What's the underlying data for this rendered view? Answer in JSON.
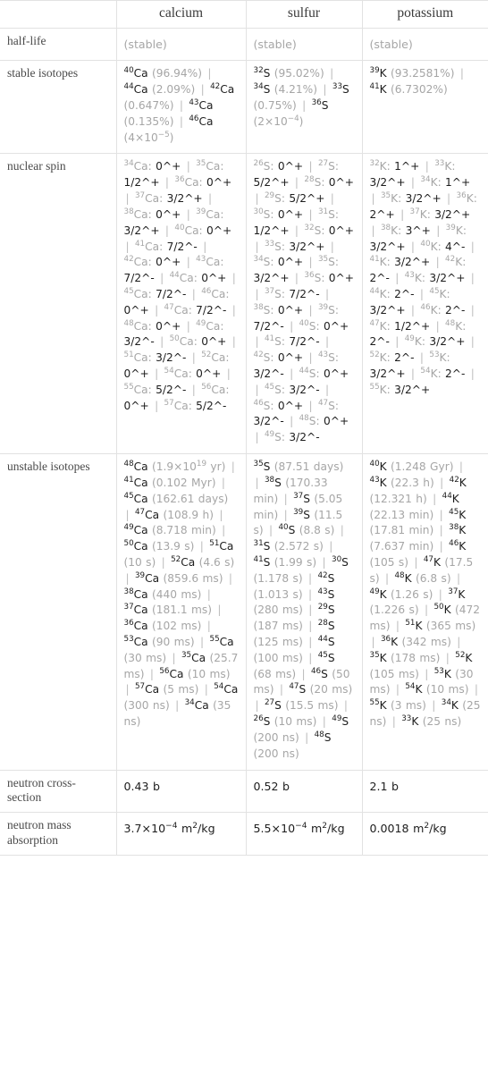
{
  "table": {
    "columns": [
      "",
      "calcium",
      "sulfur",
      "potassium"
    ],
    "rows": [
      {
        "label": "half-life",
        "kind": "plain",
        "cells": [
          {
            "type": "muted",
            "text": "(stable)"
          },
          {
            "type": "muted",
            "text": "(stable)"
          },
          {
            "type": "muted",
            "text": "(stable)"
          }
        ]
      },
      {
        "label": "stable isotopes",
        "kind": "isotopes-abundance",
        "cells": [
          {
            "items": [
              {
                "mass": "40",
                "sym": "Ca",
                "val": "(96.94%)"
              },
              {
                "mass": "44",
                "sym": "Ca",
                "val": "(2.09%)"
              },
              {
                "mass": "42",
                "sym": "Ca",
                "val": "(0.647%)"
              },
              {
                "mass": "43",
                "sym": "Ca",
                "val": "(0.135%)"
              },
              {
                "mass": "46",
                "sym": "Ca",
                "val": "(4×10^-5)"
              }
            ]
          },
          {
            "items": [
              {
                "mass": "32",
                "sym": "S",
                "val": "(95.02%)"
              },
              {
                "mass": "34",
                "sym": "S",
                "val": "(4.21%)"
              },
              {
                "mass": "33",
                "sym": "S",
                "val": "(0.75%)"
              },
              {
                "mass": "36",
                "sym": "S",
                "val": "(2×10^-4)"
              }
            ]
          },
          {
            "items": [
              {
                "mass": "39",
                "sym": "K",
                "val": "(93.2581%)"
              },
              {
                "mass": "41",
                "sym": "K",
                "val": "(6.7302%)"
              }
            ]
          }
        ]
      },
      {
        "label": "nuclear spin",
        "kind": "isotopes-spin",
        "cells": [
          {
            "items": [
              {
                "mass": "34",
                "sym": "Ca",
                "val": "0^+"
              },
              {
                "mass": "35",
                "sym": "Ca",
                "val": "1/2^+"
              },
              {
                "mass": "36",
                "sym": "Ca",
                "val": "0^+"
              },
              {
                "mass": "37",
                "sym": "Ca",
                "val": "3/2^+"
              },
              {
                "mass": "38",
                "sym": "Ca",
                "val": "0^+"
              },
              {
                "mass": "39",
                "sym": "Ca",
                "val": "3/2^+"
              },
              {
                "mass": "40",
                "sym": "Ca",
                "val": "0^+"
              },
              {
                "mass": "41",
                "sym": "Ca",
                "val": "7/2^-"
              },
              {
                "mass": "42",
                "sym": "Ca",
                "val": "0^+"
              },
              {
                "mass": "43",
                "sym": "Ca",
                "val": "7/2^-"
              },
              {
                "mass": "44",
                "sym": "Ca",
                "val": "0^+"
              },
              {
                "mass": "45",
                "sym": "Ca",
                "val": "7/2^-"
              },
              {
                "mass": "46",
                "sym": "Ca",
                "val": "0^+"
              },
              {
                "mass": "47",
                "sym": "Ca",
                "val": "7/2^-"
              },
              {
                "mass": "48",
                "sym": "Ca",
                "val": "0^+"
              },
              {
                "mass": "49",
                "sym": "Ca",
                "val": "3/2^-"
              },
              {
                "mass": "50",
                "sym": "Ca",
                "val": "0^+"
              },
              {
                "mass": "51",
                "sym": "Ca",
                "val": "3/2^-"
              },
              {
                "mass": "52",
                "sym": "Ca",
                "val": "0^+"
              },
              {
                "mass": "54",
                "sym": "Ca",
                "val": "0^+"
              },
              {
                "mass": "55",
                "sym": "Ca",
                "val": "5/2^-"
              },
              {
                "mass": "56",
                "sym": "Ca",
                "val": "0^+"
              },
              {
                "mass": "57",
                "sym": "Ca",
                "val": "5/2^-"
              }
            ]
          },
          {
            "items": [
              {
                "mass": "26",
                "sym": "S",
                "val": "0^+"
              },
              {
                "mass": "27",
                "sym": "S",
                "val": "5/2^+"
              },
              {
                "mass": "28",
                "sym": "S",
                "val": "0^+"
              },
              {
                "mass": "29",
                "sym": "S",
                "val": "5/2^+"
              },
              {
                "mass": "30",
                "sym": "S",
                "val": "0^+"
              },
              {
                "mass": "31",
                "sym": "S",
                "val": "1/2^+"
              },
              {
                "mass": "32",
                "sym": "S",
                "val": "0^+"
              },
              {
                "mass": "33",
                "sym": "S",
                "val": "3/2^+"
              },
              {
                "mass": "34",
                "sym": "S",
                "val": "0^+"
              },
              {
                "mass": "35",
                "sym": "S",
                "val": "3/2^+"
              },
              {
                "mass": "36",
                "sym": "S",
                "val": "0^+"
              },
              {
                "mass": "37",
                "sym": "S",
                "val": "7/2^-"
              },
              {
                "mass": "38",
                "sym": "S",
                "val": "0^+"
              },
              {
                "mass": "39",
                "sym": "S",
                "val": "7/2^-"
              },
              {
                "mass": "40",
                "sym": "S",
                "val": "0^+"
              },
              {
                "mass": "41",
                "sym": "S",
                "val": "7/2^-"
              },
              {
                "mass": "42",
                "sym": "S",
                "val": "0^+"
              },
              {
                "mass": "43",
                "sym": "S",
                "val": "3/2^-"
              },
              {
                "mass": "44",
                "sym": "S",
                "val": "0^+"
              },
              {
                "mass": "45",
                "sym": "S",
                "val": "3/2^-"
              },
              {
                "mass": "46",
                "sym": "S",
                "val": "0^+"
              },
              {
                "mass": "47",
                "sym": "S",
                "val": "3/2^-"
              },
              {
                "mass": "48",
                "sym": "S",
                "val": "0^+"
              },
              {
                "mass": "49",
                "sym": "S",
                "val": "3/2^-"
              }
            ]
          },
          {
            "items": [
              {
                "mass": "32",
                "sym": "K",
                "val": "1^+"
              },
              {
                "mass": "33",
                "sym": "K",
                "val": "3/2^+"
              },
              {
                "mass": "34",
                "sym": "K",
                "val": "1^+"
              },
              {
                "mass": "35",
                "sym": "K",
                "val": "3/2^+"
              },
              {
                "mass": "36",
                "sym": "K",
                "val": "2^+"
              },
              {
                "mass": "37",
                "sym": "K",
                "val": "3/2^+"
              },
              {
                "mass": "38",
                "sym": "K",
                "val": "3^+"
              },
              {
                "mass": "39",
                "sym": "K",
                "val": "3/2^+"
              },
              {
                "mass": "40",
                "sym": "K",
                "val": "4^-"
              },
              {
                "mass": "41",
                "sym": "K",
                "val": "3/2^+"
              },
              {
                "mass": "42",
                "sym": "K",
                "val": "2^-"
              },
              {
                "mass": "43",
                "sym": "K",
                "val": "3/2^+"
              },
              {
                "mass": "44",
                "sym": "K",
                "val": "2^-"
              },
              {
                "mass": "45",
                "sym": "K",
                "val": "3/2^+"
              },
              {
                "mass": "46",
                "sym": "K",
                "val": "2^-"
              },
              {
                "mass": "47",
                "sym": "K",
                "val": "1/2^+"
              },
              {
                "mass": "48",
                "sym": "K",
                "val": "2^-"
              },
              {
                "mass": "49",
                "sym": "K",
                "val": "3/2^+"
              },
              {
                "mass": "52",
                "sym": "K",
                "val": "2^-"
              },
              {
                "mass": "53",
                "sym": "K",
                "val": "3/2^+"
              },
              {
                "mass": "54",
                "sym": "K",
                "val": "2^-"
              },
              {
                "mass": "55",
                "sym": "K",
                "val": "3/2^+"
              }
            ]
          }
        ]
      },
      {
        "label": "unstable isotopes",
        "kind": "isotopes-halflife",
        "cells": [
          {
            "items": [
              {
                "mass": "48",
                "sym": "Ca",
                "val": "(1.9×10^19 yr)"
              },
              {
                "mass": "41",
                "sym": "Ca",
                "val": "(0.102 Myr)"
              },
              {
                "mass": "45",
                "sym": "Ca",
                "val": "(162.61 days)"
              },
              {
                "mass": "47",
                "sym": "Ca",
                "val": "(108.9 h)"
              },
              {
                "mass": "49",
                "sym": "Ca",
                "val": "(8.718 min)"
              },
              {
                "mass": "50",
                "sym": "Ca",
                "val": "(13.9 s)"
              },
              {
                "mass": "51",
                "sym": "Ca",
                "val": "(10 s)"
              },
              {
                "mass": "52",
                "sym": "Ca",
                "val": "(4.6 s)"
              },
              {
                "mass": "39",
                "sym": "Ca",
                "val": "(859.6 ms)"
              },
              {
                "mass": "38",
                "sym": "Ca",
                "val": "(440 ms)"
              },
              {
                "mass": "37",
                "sym": "Ca",
                "val": "(181.1 ms)"
              },
              {
                "mass": "36",
                "sym": "Ca",
                "val": "(102 ms)"
              },
              {
                "mass": "53",
                "sym": "Ca",
                "val": "(90 ms)"
              },
              {
                "mass": "55",
                "sym": "Ca",
                "val": "(30 ms)"
              },
              {
                "mass": "35",
                "sym": "Ca",
                "val": "(25.7 ms)"
              },
              {
                "mass": "56",
                "sym": "Ca",
                "val": "(10 ms)"
              },
              {
                "mass": "57",
                "sym": "Ca",
                "val": "(5 ms)"
              },
              {
                "mass": "54",
                "sym": "Ca",
                "val": "(300 ns)"
              },
              {
                "mass": "34",
                "sym": "Ca",
                "val": "(35 ns)"
              }
            ]
          },
          {
            "items": [
              {
                "mass": "35",
                "sym": "S",
                "val": "(87.51 days)"
              },
              {
                "mass": "38",
                "sym": "S",
                "val": "(170.33 min)"
              },
              {
                "mass": "37",
                "sym": "S",
                "val": "(5.05 min)"
              },
              {
                "mass": "39",
                "sym": "S",
                "val": "(11.5 s)"
              },
              {
                "mass": "40",
                "sym": "S",
                "val": "(8.8 s)"
              },
              {
                "mass": "31",
                "sym": "S",
                "val": "(2.572 s)"
              },
              {
                "mass": "41",
                "sym": "S",
                "val": "(1.99 s)"
              },
              {
                "mass": "30",
                "sym": "S",
                "val": "(1.178 s)"
              },
              {
                "mass": "42",
                "sym": "S",
                "val": "(1.013 s)"
              },
              {
                "mass": "43",
                "sym": "S",
                "val": "(280 ms)"
              },
              {
                "mass": "29",
                "sym": "S",
                "val": "(187 ms)"
              },
              {
                "mass": "28",
                "sym": "S",
                "val": "(125 ms)"
              },
              {
                "mass": "44",
                "sym": "S",
                "val": "(100 ms)"
              },
              {
                "mass": "45",
                "sym": "S",
                "val": "(68 ms)"
              },
              {
                "mass": "46",
                "sym": "S",
                "val": "(50 ms)"
              },
              {
                "mass": "47",
                "sym": "S",
                "val": "(20 ms)"
              },
              {
                "mass": "27",
                "sym": "S",
                "val": "(15.5 ms)"
              },
              {
                "mass": "26",
                "sym": "S",
                "val": "(10 ms)"
              },
              {
                "mass": "49",
                "sym": "S",
                "val": "(200 ns)"
              },
              {
                "mass": "48",
                "sym": "S",
                "val": "(200 ns)"
              }
            ]
          },
          {
            "items": [
              {
                "mass": "40",
                "sym": "K",
                "val": "(1.248 Gyr)"
              },
              {
                "mass": "43",
                "sym": "K",
                "val": "(22.3 h)"
              },
              {
                "mass": "42",
                "sym": "K",
                "val": "(12.321 h)"
              },
              {
                "mass": "44",
                "sym": "K",
                "val": "(22.13 min)"
              },
              {
                "mass": "45",
                "sym": "K",
                "val": "(17.81 min)"
              },
              {
                "mass": "38",
                "sym": "K",
                "val": "(7.637 min)"
              },
              {
                "mass": "46",
                "sym": "K",
                "val": "(105 s)"
              },
              {
                "mass": "47",
                "sym": "K",
                "val": "(17.5 s)"
              },
              {
                "mass": "48",
                "sym": "K",
                "val": "(6.8 s)"
              },
              {
                "mass": "49",
                "sym": "K",
                "val": "(1.26 s)"
              },
              {
                "mass": "37",
                "sym": "K",
                "val": "(1.226 s)"
              },
              {
                "mass": "50",
                "sym": "K",
                "val": "(472 ms)"
              },
              {
                "mass": "51",
                "sym": "K",
                "val": "(365 ms)"
              },
              {
                "mass": "36",
                "sym": "K",
                "val": "(342 ms)"
              },
              {
                "mass": "35",
                "sym": "K",
                "val": "(178 ms)"
              },
              {
                "mass": "52",
                "sym": "K",
                "val": "(105 ms)"
              },
              {
                "mass": "53",
                "sym": "K",
                "val": "(30 ms)"
              },
              {
                "mass": "54",
                "sym": "K",
                "val": "(10 ms)"
              },
              {
                "mass": "55",
                "sym": "K",
                "val": "(3 ms)"
              },
              {
                "mass": "34",
                "sym": "K",
                "val": "(25 ns)"
              },
              {
                "mass": "33",
                "sym": "K",
                "val": "(25 ns)"
              }
            ]
          }
        ]
      },
      {
        "label": "neutron cross-section",
        "kind": "plain",
        "cells": [
          {
            "type": "dark",
            "text": "0.43 b"
          },
          {
            "type": "dark",
            "text": "0.52 b"
          },
          {
            "type": "dark",
            "text": "2.1 b"
          }
        ]
      },
      {
        "label": "neutron mass absorption",
        "kind": "plain",
        "cells": [
          {
            "type": "dark",
            "text": "3.7×10^-4 m^2/kg"
          },
          {
            "type": "dark",
            "text": "5.5×10^-4 m^2/kg"
          },
          {
            "type": "dark",
            "text": "0.0018 m^2/kg"
          }
        ]
      }
    ]
  },
  "colors": {
    "text": "#1d1d1d",
    "muted": "#a6a6a6",
    "label": "#4a4a4a",
    "border": "#e2e2e2",
    "background": "#ffffff"
  }
}
